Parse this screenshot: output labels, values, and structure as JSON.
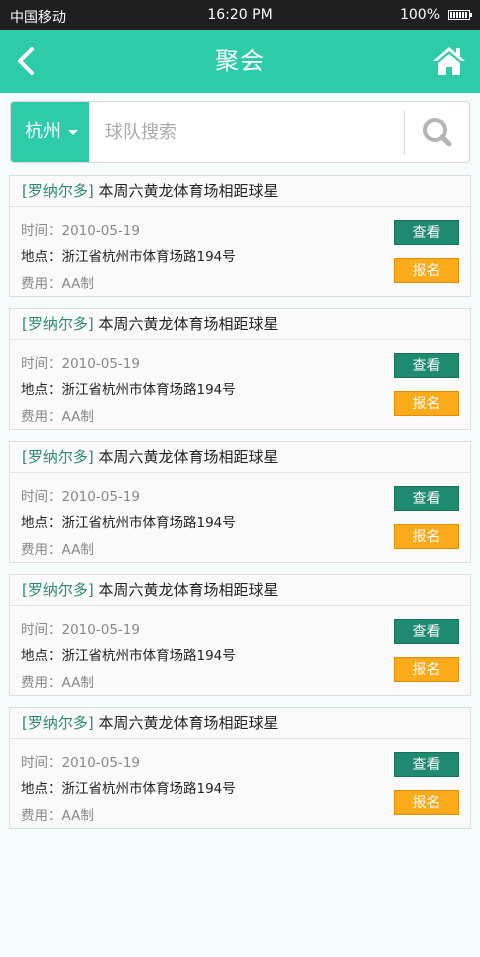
{
  "status_bar": {
    "carrier": "中国移动",
    "time": "16:20 PM",
    "battery": "100%"
  },
  "header": {
    "title": "聚会"
  },
  "search": {
    "city": "杭州",
    "placeholder": "球队搜索"
  },
  "colors": {
    "brand": "#2ecbaa",
    "view_button": "#1e8a70",
    "signup_button": "#fbaa1a",
    "team_text": "#2a8a74"
  },
  "events": [
    {
      "team": "[罗纳尔多]",
      "title": " 本周六黄龙体育场相距球星",
      "time": "时间：2010-05-19",
      "place": "地点：浙江省杭州市体育场路194号",
      "fee": "费用：AA制",
      "view_label": "查看",
      "signup_label": "报名"
    },
    {
      "team": "[罗纳尔多]",
      "title": " 本周六黄龙体育场相距球星",
      "time": "时间：2010-05-19",
      "place": "地点：浙江省杭州市体育场路194号",
      "fee": "费用：AA制",
      "view_label": "查看",
      "signup_label": "报名"
    },
    {
      "team": "[罗纳尔多]",
      "title": " 本周六黄龙体育场相距球星",
      "time": "时间：2010-05-19",
      "place": "地点：浙江省杭州市体育场路194号",
      "fee": "费用：AA制",
      "view_label": "查看",
      "signup_label": "报名"
    },
    {
      "team": "[罗纳尔多]",
      "title": " 本周六黄龙体育场相距球星",
      "time": "时间：2010-05-19",
      "place": "地点：浙江省杭州市体育场路194号",
      "fee": "费用：AA制",
      "view_label": "查看",
      "signup_label": "报名"
    },
    {
      "team": "[罗纳尔多]",
      "title": " 本周六黄龙体育场相距球星",
      "time": "时间：2010-05-19",
      "place": "地点：浙江省杭州市体育场路194号",
      "fee": "费用：AA制",
      "view_label": "查看",
      "signup_label": "报名"
    }
  ]
}
